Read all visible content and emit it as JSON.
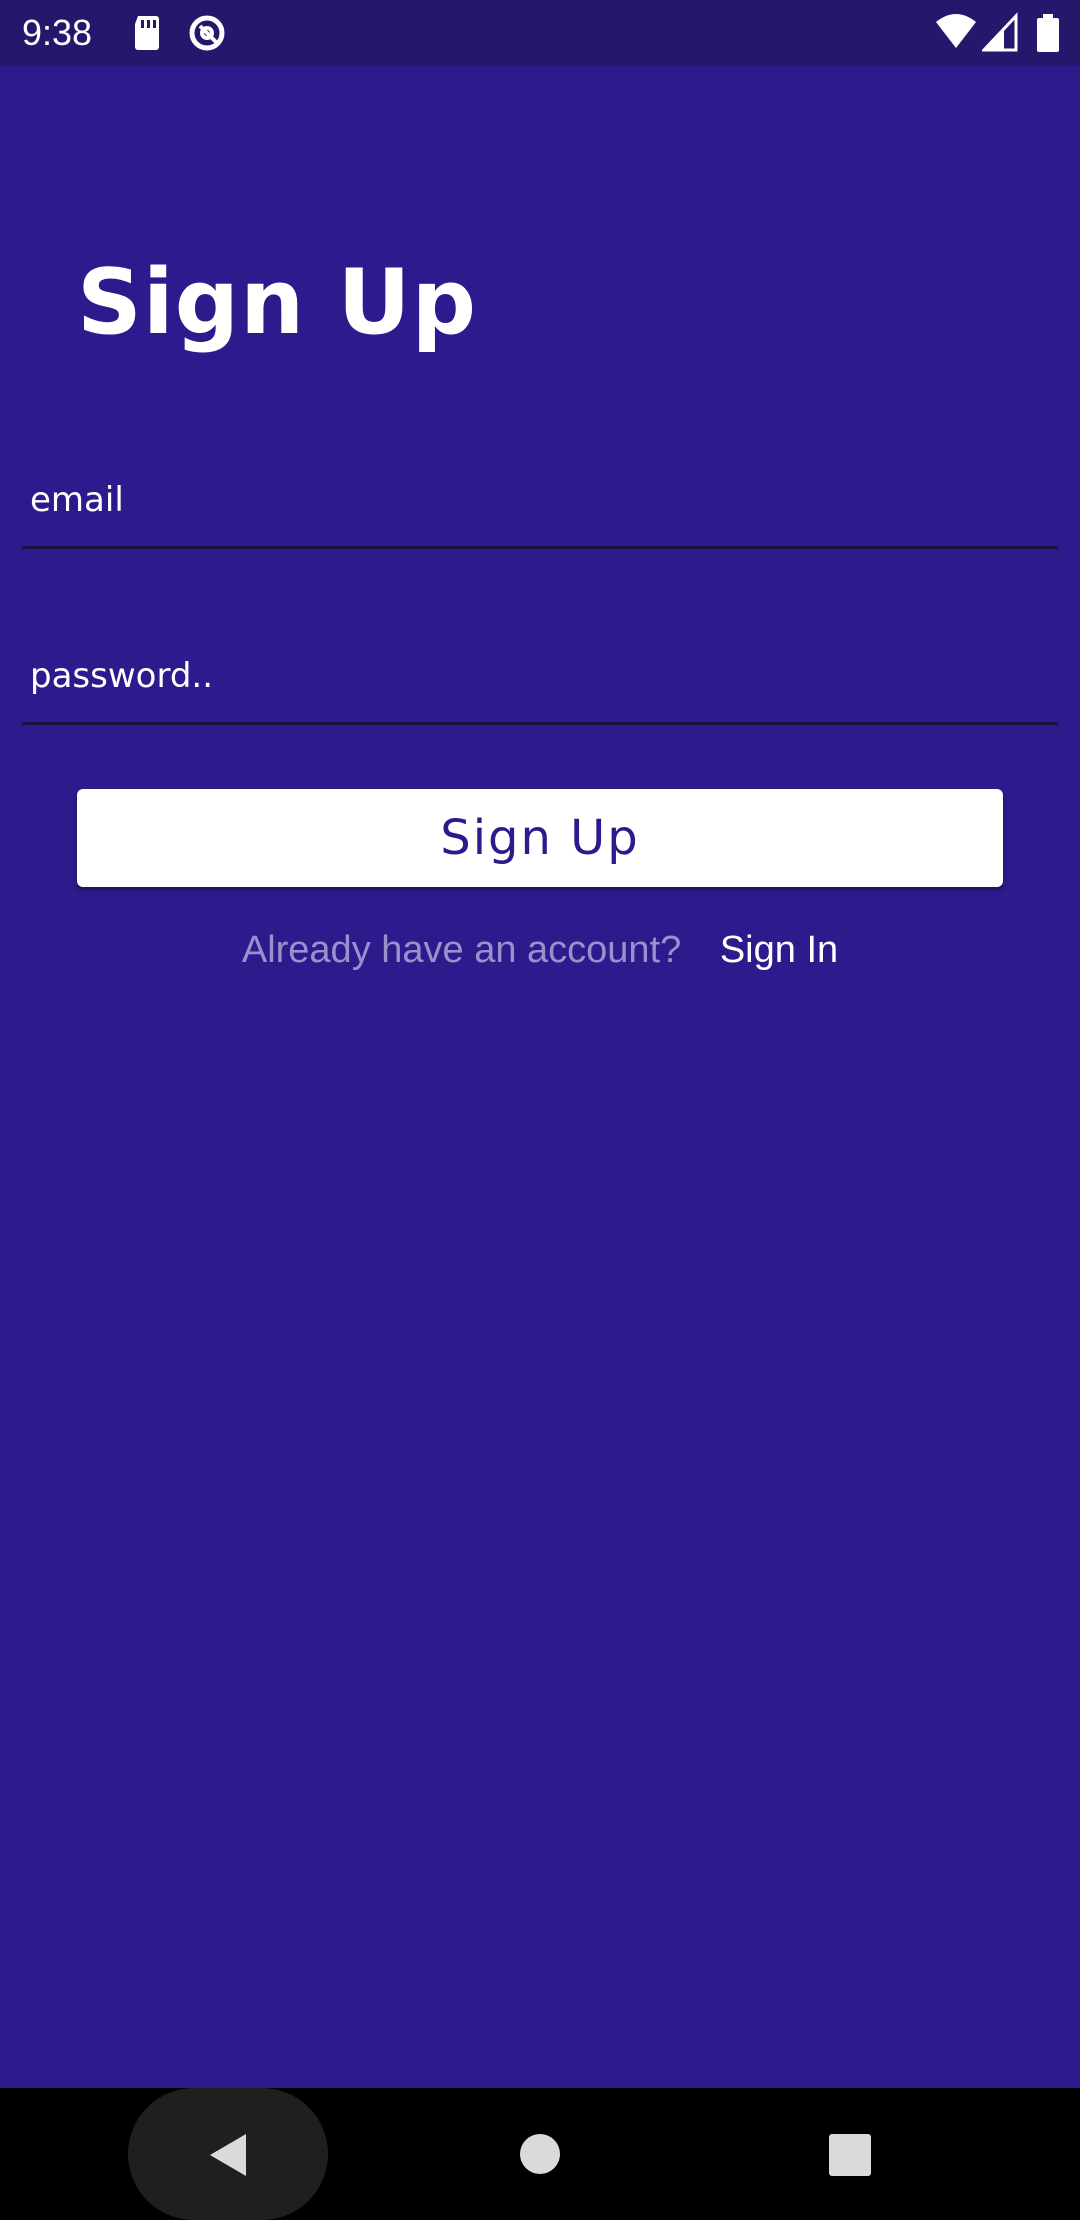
{
  "status_bar": {
    "time": "9:38",
    "icons": [
      "sd-card-icon",
      "sync-icon",
      "wifi-icon",
      "signal-icon",
      "battery-icon"
    ]
  },
  "form": {
    "title": "Sign Up",
    "email_placeholder": "email",
    "password_placeholder": "password..",
    "submit_label": "Sign Up",
    "account_question": "Already have an account?",
    "sign_in_label": "Sign In"
  },
  "nav_bar": {
    "buttons": [
      "back-icon",
      "home-icon",
      "recents-icon"
    ]
  },
  "colors": {
    "background": "#2E1A8C",
    "status_bar": "#25176C",
    "button_bg": "#FFFFFF",
    "button_text": "#2E1A8C",
    "muted_text": "#9A91CC"
  }
}
